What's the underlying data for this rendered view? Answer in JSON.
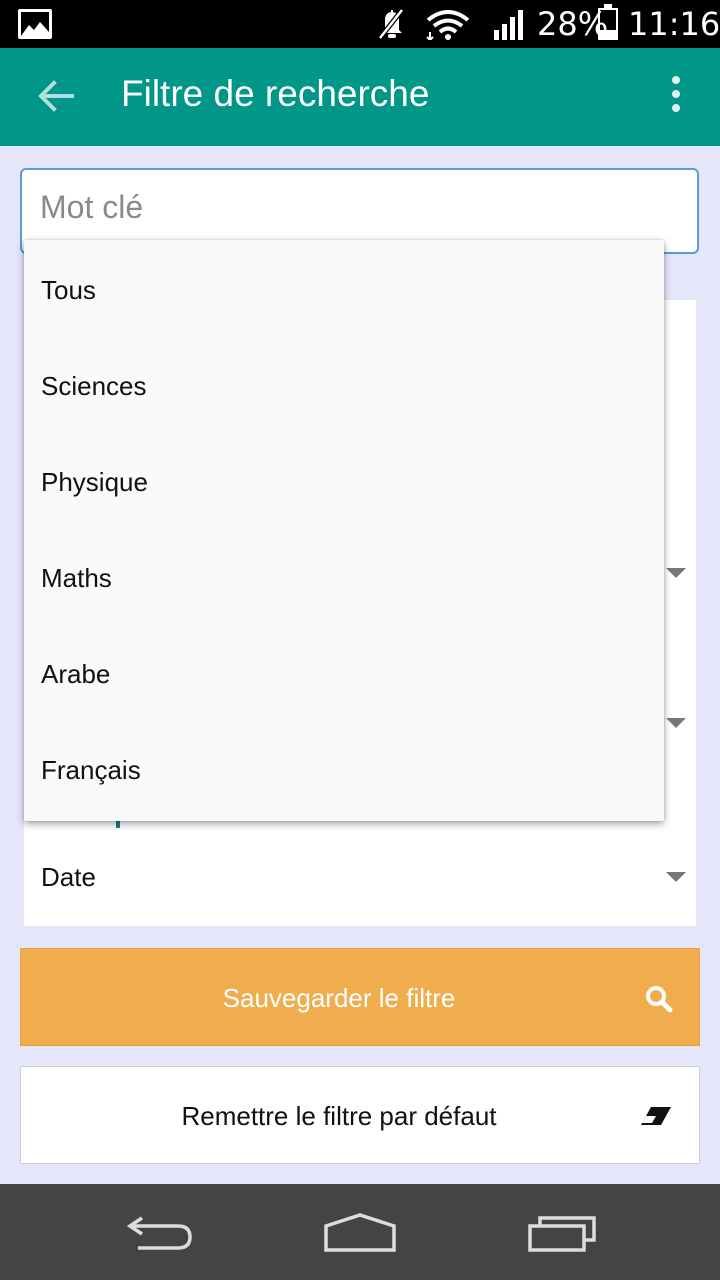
{
  "status_bar": {
    "battery_percent": "28%",
    "battery_level": 0.28,
    "clock": "11:16",
    "icons": [
      "image-icon",
      "mute-icon",
      "wifi-icon",
      "signal-icon",
      "battery-icon"
    ]
  },
  "app_bar": {
    "title": "Filtre de recherche",
    "color": "#009688",
    "back_icon": "arrow-back-icon",
    "menu_icon": "more-vert-icon"
  },
  "search": {
    "placeholder": "Mot clé",
    "value": ""
  },
  "dropdown": {
    "options": [
      "Tous",
      "Sciences",
      "Physique",
      "Maths",
      "Arabe",
      "Français"
    ]
  },
  "filter_card": {
    "sort_label": "Date"
  },
  "buttons": {
    "save_label": "Sauvegarder le filtre",
    "save_color": "#f0ad4e",
    "save_icon": "search-icon",
    "reset_label": "Remettre le filtre par défaut",
    "reset_icon": "eraser-icon"
  },
  "nav_bar": {
    "icons": [
      "back-icon",
      "home-icon",
      "recents-icon"
    ]
  }
}
